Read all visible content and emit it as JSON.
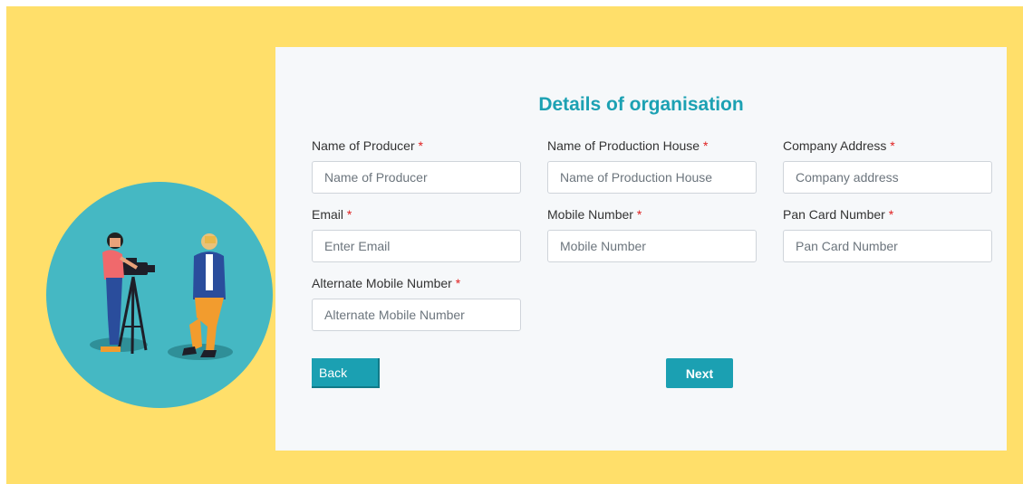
{
  "form": {
    "title": "Details of organisation",
    "required_mark": "*",
    "fields": [
      {
        "label": "Name of Producer",
        "placeholder": "Name of Producer",
        "value": ""
      },
      {
        "label": "Name of Production House",
        "placeholder": "Name of Production House",
        "value": ""
      },
      {
        "label": "Company Address",
        "placeholder": "Company address",
        "value": ""
      },
      {
        "label": "Email",
        "placeholder": "Enter Email",
        "value": ""
      },
      {
        "label": "Mobile Number",
        "placeholder": "Mobile Number",
        "value": ""
      },
      {
        "label": "Pan Card Number",
        "placeholder": "Pan Card Number",
        "value": ""
      },
      {
        "label": "Alternate Mobile Number",
        "placeholder": "Alternate Mobile Number",
        "value": ""
      }
    ],
    "back_label": "Back",
    "next_label": "Next"
  },
  "colors": {
    "background": "#ffdf6a",
    "card": "#f6f8fa",
    "accent": "#1ba0b2",
    "required": "#e02020",
    "illustration_circle": "#45b8c3"
  },
  "illustration": {
    "icon": "cameraman-and-producer-illustration"
  }
}
